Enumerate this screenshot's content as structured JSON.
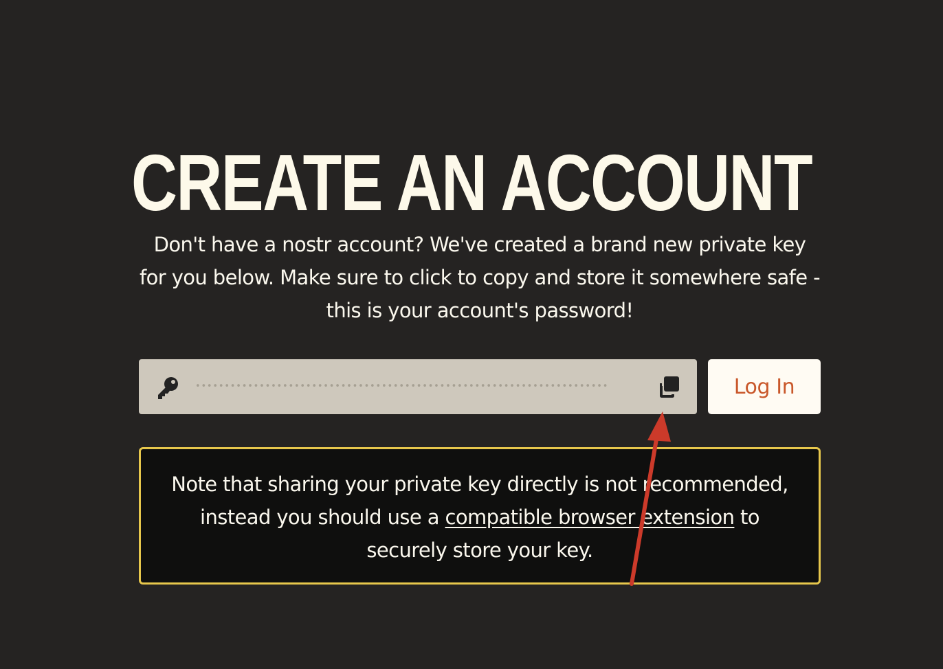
{
  "page": {
    "title": "CREATE AN ACCOUNT",
    "intro": "Don't have a nostr account? We've created a brand new private key for you below. Make sure to click to copy and store it somewhere safe - this is your account's password!"
  },
  "key_field": {
    "icon": "key-icon",
    "masked_value": "••••••••••••••••••••••••••••••••••••••••••••••••••••••••••••••••••••••••••••••••••••••••",
    "copy_icon": "copy-icon"
  },
  "login_button": {
    "label": "Log In"
  },
  "note": {
    "text_before": "Note that sharing your private key directly is not recommended, instead you should use a ",
    "link": "compatible browser extension",
    "text_after": " to securely store your key."
  },
  "annotation": {
    "arrow_color": "#cc3a2a",
    "points_to": "copy-icon"
  },
  "colors": {
    "background": "#252322",
    "text": "#fbf8ee",
    "field_bg": "#cec8bc",
    "button_bg": "#fffbf3",
    "button_text": "#c9572a",
    "note_border": "#e7c74c",
    "note_bg": "#0f0f0e"
  }
}
